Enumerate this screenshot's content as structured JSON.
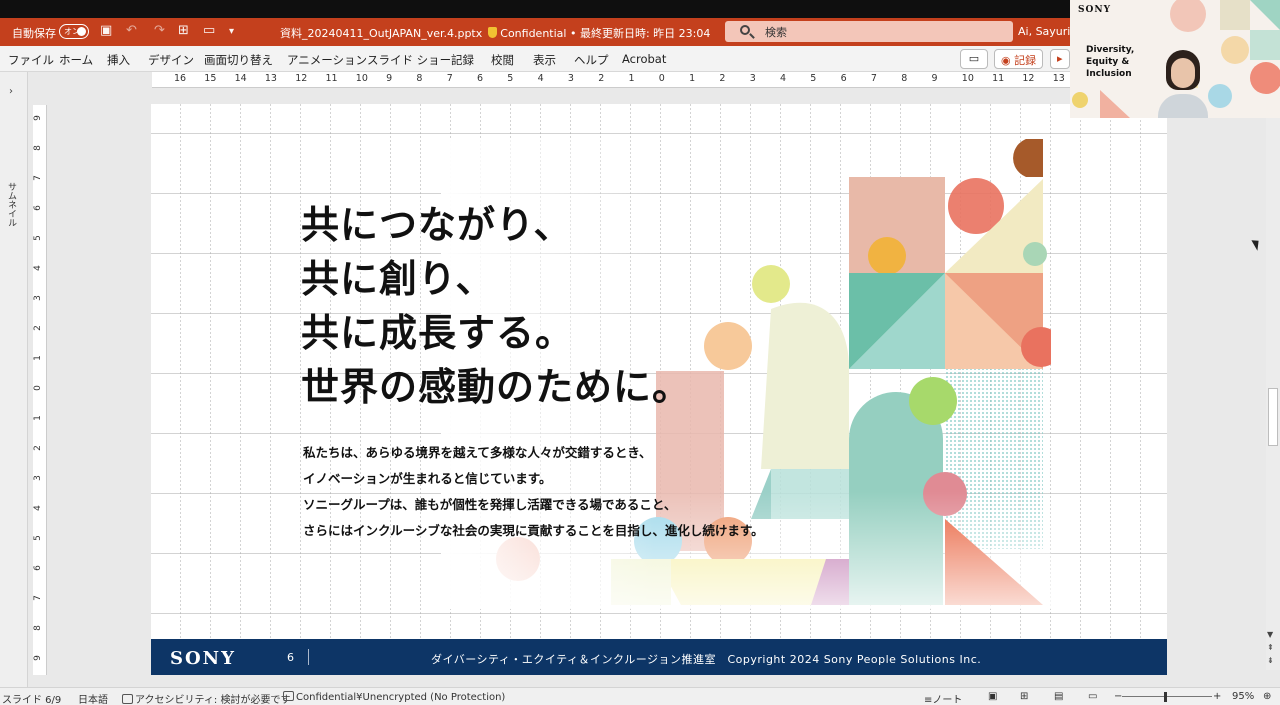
{
  "title_bar": {
    "autosave_label": "自動保存",
    "autosave_toggle": "オン",
    "filename": "資料_20240411_OutJAPAN_ver.4.pptx",
    "sensitivity": "Confidential",
    "last_saved": "• 最終更新日時: 昨日 23:04",
    "search_placeholder": "検索",
    "user_name": "Ai, Sayuri (SP"
  },
  "ribbon": {
    "tabs": [
      "ファイル",
      "ホーム",
      "挿入",
      "デザイン",
      "画面切り替え",
      "アニメーション",
      "スライド ショー",
      "記録",
      "校閲",
      "表示",
      "ヘルプ",
      "Acrobat"
    ],
    "record_button": "記録"
  },
  "ruler": {
    "horizontal": [
      "16",
      "15",
      "14",
      "13",
      "12",
      "11",
      "10",
      "9",
      "8",
      "7",
      "6",
      "5",
      "4",
      "3",
      "2",
      "1",
      "0",
      "1",
      "2",
      "3",
      "4",
      "5",
      "6",
      "7",
      "8",
      "9",
      "10",
      "11",
      "12",
      "13"
    ],
    "vertical": [
      "9",
      "8",
      "7",
      "6",
      "5",
      "4",
      "3",
      "2",
      "1",
      "0",
      "1",
      "2",
      "3",
      "4",
      "5",
      "6",
      "7",
      "8",
      "9"
    ]
  },
  "thumbnail_pane": {
    "label": "サムネイル"
  },
  "slide": {
    "headline": [
      "共につながり、",
      "共に創り、",
      "共に成長する。",
      "世界の感動のために。"
    ],
    "body": [
      "私たちは、あらゆる境界を越えて多様な人々が交錯するとき、",
      "イノベーションが生まれると信じています。",
      "ソニーグループは、誰もが個性を発揮し活躍できる場であること、",
      "さらにはインクルーシブな社会の実現に貢献することを目指し、進化し続けます。"
    ],
    "footer": {
      "logo": "SONY",
      "page_number": "6",
      "text": "ダイバーシティ・エクイティ＆インクルージョン推進室　Copyright 2024 Sony People Solutions Inc."
    }
  },
  "video_overlay": {
    "logo": "SONY",
    "title_lines": [
      "Diversity,",
      "Equity &",
      "Inclusion"
    ]
  },
  "status_bar": {
    "slide_indicator": "スライド 6/9",
    "language": "日本語",
    "accessibility": "アクセシビリティ: 検討が必要です",
    "sensitivity": "Confidential¥Unencrypted (No Protection)",
    "notes": "ノート",
    "zoom": "95%"
  },
  "colors": {
    "title_bar": "#c4401d",
    "footer_navy": "#0d3566",
    "accent_coral": "#e9725f",
    "accent_teal": "#8ccfc0",
    "accent_yellow": "#f1c232"
  }
}
